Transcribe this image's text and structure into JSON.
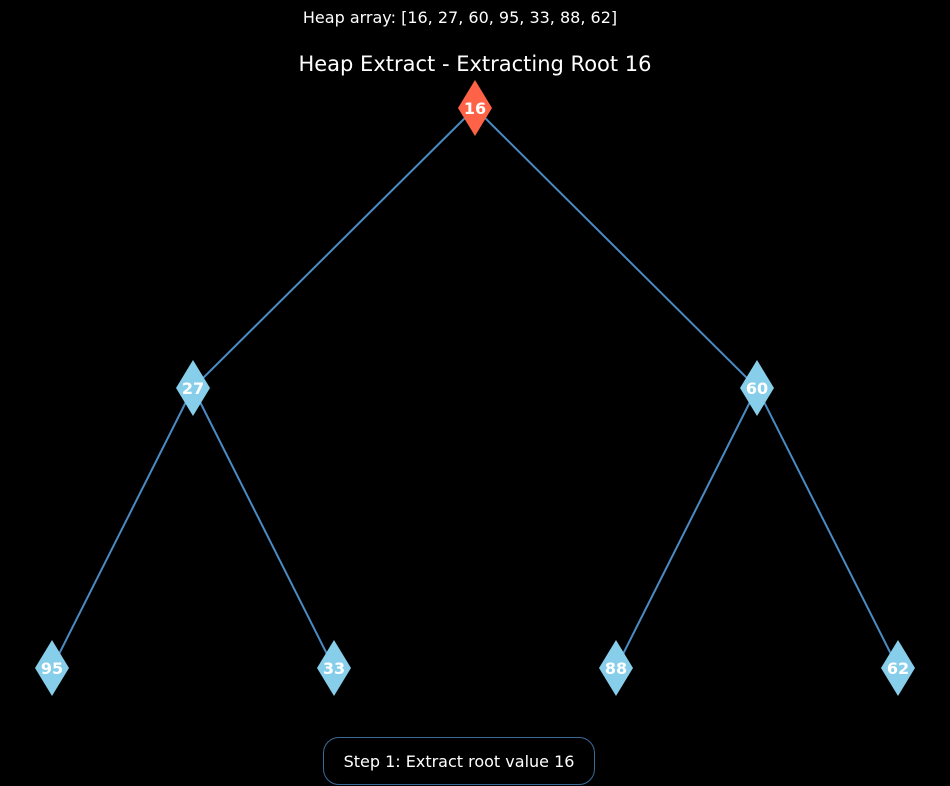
{
  "heap_array_text": "Heap array: [16, 27, 60, 95, 33, 88, 62]",
  "title": "Heap Extract - Extracting Root 16",
  "step_text": "Step 1: Extract root value 16",
  "colors": {
    "background": "#000000",
    "edge": "#4a8bc4",
    "node": "#87ceeb",
    "highlight_node": "#ff6347",
    "label": "#ffffff"
  },
  "nodes": [
    {
      "index": 0,
      "value": "16",
      "highlight": true
    },
    {
      "index": 1,
      "value": "27",
      "highlight": false
    },
    {
      "index": 2,
      "value": "60",
      "highlight": false
    },
    {
      "index": 3,
      "value": "95",
      "highlight": false
    },
    {
      "index": 4,
      "value": "33",
      "highlight": false
    },
    {
      "index": 5,
      "value": "88",
      "highlight": false
    },
    {
      "index": 6,
      "value": "62",
      "highlight": false
    }
  ],
  "edges": [
    {
      "from": 0,
      "to": 1
    },
    {
      "from": 0,
      "to": 2
    },
    {
      "from": 1,
      "to": 3
    },
    {
      "from": 1,
      "to": 4
    },
    {
      "from": 2,
      "to": 5
    },
    {
      "from": 2,
      "to": 6
    }
  ]
}
